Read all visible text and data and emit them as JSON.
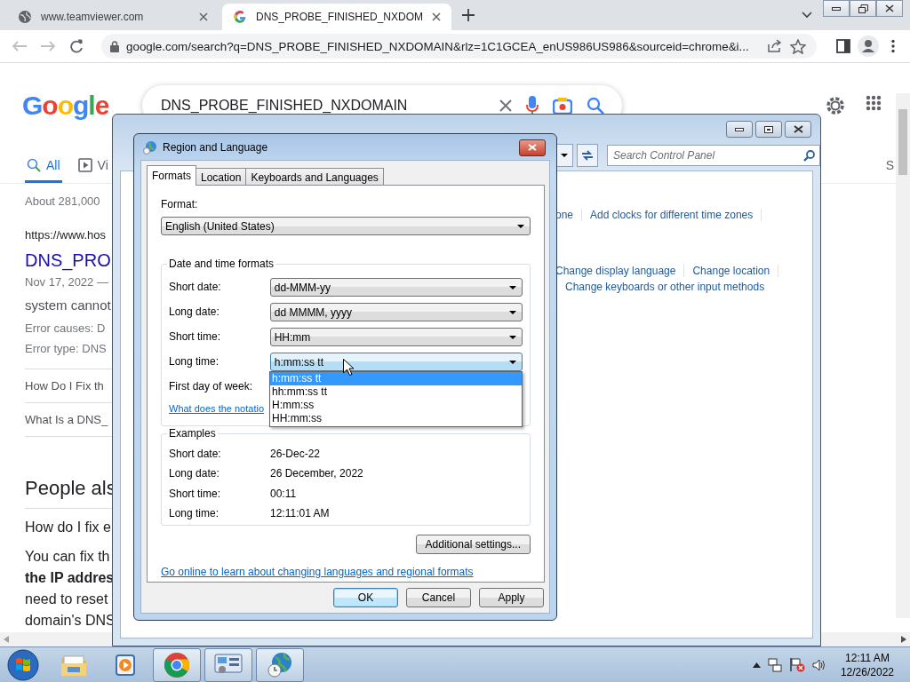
{
  "browser": {
    "tabs": [
      {
        "title": "www.teamviewer.com",
        "selected": false
      },
      {
        "title": "DNS_PROBE_FINISHED_NXDOM",
        "selected": true
      }
    ],
    "url": "google.com/search?q=DNS_PROBE_FINISHED_NXDOMAIN&rlz=1C1GCEA_enUS986US986&sourceid=chrome&i..."
  },
  "google": {
    "logo": "Google",
    "query": "DNS_PROBE_FINISHED_NXDOMAIN",
    "tabs": [
      {
        "label": "All",
        "selected": true
      },
      {
        "label": "Vi",
        "selected": false
      }
    ],
    "tab_right": "S",
    "stats": "About 281,000",
    "result": {
      "url": "https://www.hos",
      "title": "DNS_PRO",
      "date": "Nov 17, 2022 —",
      "snippet": "system cannot",
      "facts": [
        "Error causes: D",
        "Error type: DNS"
      ],
      "links": [
        "How Do I Fix th",
        "What Is a DNS_"
      ]
    },
    "people_also_ask": {
      "heading": "People als",
      "question": "How do I fix e",
      "answer_lines": [
        {
          "text": "You can fix th",
          "bold": false
        },
        {
          "text": "the IP addres",
          "bold": true
        },
        {
          "text": "need to reset",
          "bold": false
        },
        {
          "text": "domain's DNS",
          "bold": false
        }
      ]
    }
  },
  "control_panel": {
    "search_placeholder": "Search Control Panel",
    "link_groups": [
      {
        "rows": [
          [
            "one",
            "Add clocks for different time zones"
          ]
        ]
      },
      {
        "rows": [
          [
            "Change display language",
            "Change location"
          ],
          [
            "Change keyboards or other input methods"
          ]
        ]
      }
    ]
  },
  "dialog": {
    "title": "Region and Language",
    "tabs": [
      {
        "label": "Formats",
        "selected": true
      },
      {
        "label": "Location",
        "selected": false
      },
      {
        "label": "Keyboards and Languages",
        "selected": false
      }
    ],
    "format_label": "Format:",
    "format_value": "English (United States)",
    "date_time": {
      "title": "Date and time formats",
      "rows": [
        {
          "label": "Short date:",
          "value": "dd-MMM-yy",
          "focused": false
        },
        {
          "label": "Long date:",
          "value": "dd MMMM, yyyy",
          "focused": false
        },
        {
          "label": "Short time:",
          "value": "HH:mm",
          "focused": false
        },
        {
          "label": "Long time:",
          "value": "h:mm:ss tt",
          "focused": true
        }
      ],
      "first_day_label": "First day of week:",
      "notation_link": "What does the notatio"
    },
    "dropdown": [
      {
        "text": "h:mm:ss tt",
        "selected": true
      },
      {
        "text": "hh:mm:ss tt",
        "selected": false
      },
      {
        "text": "H:mm:ss",
        "selected": false
      },
      {
        "text": "HH:mm:ss",
        "selected": false
      }
    ],
    "examples": {
      "title": "Examples",
      "rows": [
        {
          "label": "Short date:",
          "value": "26-Dec-22"
        },
        {
          "label": "Long date:",
          "value": "26 December, 2022"
        },
        {
          "label": "Short time:",
          "value": "00:11"
        },
        {
          "label": "Long time:",
          "value": "12:11:01 AM"
        }
      ]
    },
    "additional_button": "Additional settings...",
    "online_link": "Go online to learn about changing languages and regional formats",
    "buttons": [
      {
        "label": "OK",
        "default": true
      },
      {
        "label": "Cancel",
        "default": false
      },
      {
        "label": "Apply",
        "default": false
      }
    ]
  },
  "taskbar": {
    "apps": [
      {
        "kind": "folder",
        "open": false
      },
      {
        "kind": "media",
        "open": false
      },
      {
        "kind": "chrome",
        "open": true
      },
      {
        "kind": "control-panel",
        "open": true
      },
      {
        "kind": "region",
        "open": true
      }
    ],
    "time": "12:11 AM",
    "date": "12/26/2022"
  }
}
